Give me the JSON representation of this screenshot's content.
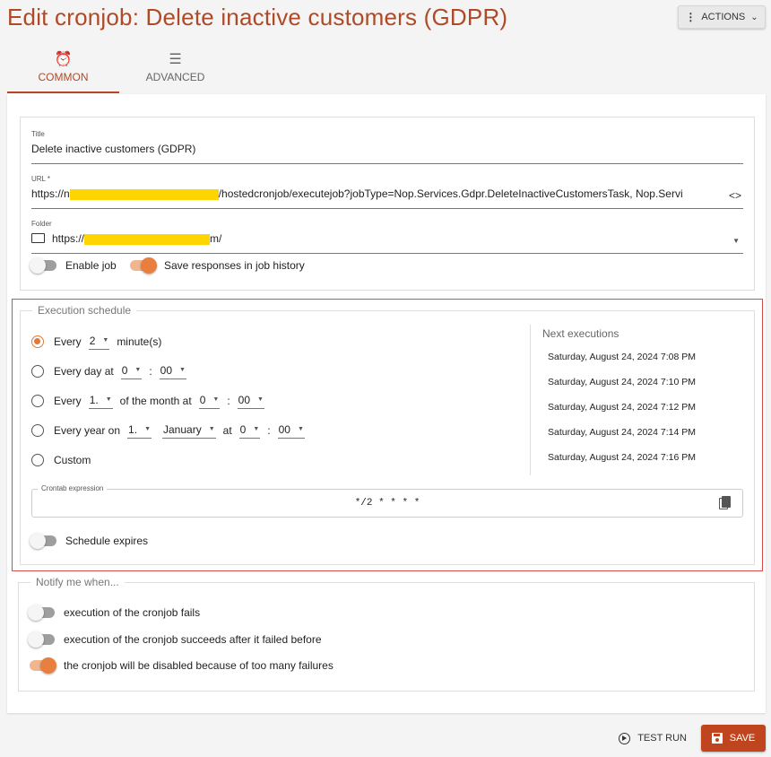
{
  "header": {
    "title": "Edit cronjob: Delete inactive customers (GDPR)",
    "actions_label": "ACTIONS"
  },
  "tabs": [
    {
      "label": "COMMON",
      "icon": "alarm-clock-icon"
    },
    {
      "label": "ADVANCED",
      "icon": "sliders-icon"
    }
  ],
  "general": {
    "title_label": "Title",
    "title_value": "Delete inactive customers (GDPR)",
    "url_label": "URL *",
    "url_prefix": "https://n",
    "url_suffix": "/hostedcronjob/executejob?jobType=Nop.Services.Gdpr.DeleteInactiveCustomersTask, Nop.Servi",
    "folder_label": "Folder",
    "folder_prefix": "https://",
    "folder_suffix": "m/",
    "enable_job_label": "Enable job",
    "save_responses_label": "Save responses in job history"
  },
  "schedule": {
    "legend": "Execution schedule",
    "every_label": "Every",
    "minutes_value": "2",
    "minutes_label": "minute(s)",
    "every_day_label": "Every day at",
    "day_hour": "0",
    "day_minute": "00",
    "month_every_label": "Every",
    "month_day": "1.",
    "month_of_label": "of the month at",
    "month_hour": "0",
    "month_minute": "00",
    "year_label": "Every year on",
    "year_day": "1.",
    "year_month": "January",
    "year_at_label": "at",
    "year_hour": "0",
    "year_minute": "00",
    "custom_label": "Custom",
    "colon": ":",
    "next_title": "Next executions",
    "next_executions": [
      "Saturday, August 24, 2024 7:08 PM",
      "Saturday, August 24, 2024 7:10 PM",
      "Saturday, August 24, 2024 7:12 PM",
      "Saturday, August 24, 2024 7:14 PM",
      "Saturday, August 24, 2024 7:16 PM"
    ],
    "crontab_label": "Crontab expression",
    "crontab_value": "*/2 * * * *",
    "expires_label": "Schedule expires"
  },
  "notify": {
    "legend": "Notify me when...",
    "fails_label": "execution of the cronjob fails",
    "succeeds_label": "execution of the cronjob succeeds after it failed before",
    "disabled_label": "the cronjob will be disabled because of too many failures"
  },
  "footer": {
    "test_run_label": "TEST RUN",
    "save_label": "SAVE"
  },
  "colors": {
    "accent": "#b04a26",
    "toggle_on": "#e87f3e",
    "save_button": "#c0451f",
    "highlight_frame": "#d94a4a",
    "redaction": "#ffd400"
  }
}
